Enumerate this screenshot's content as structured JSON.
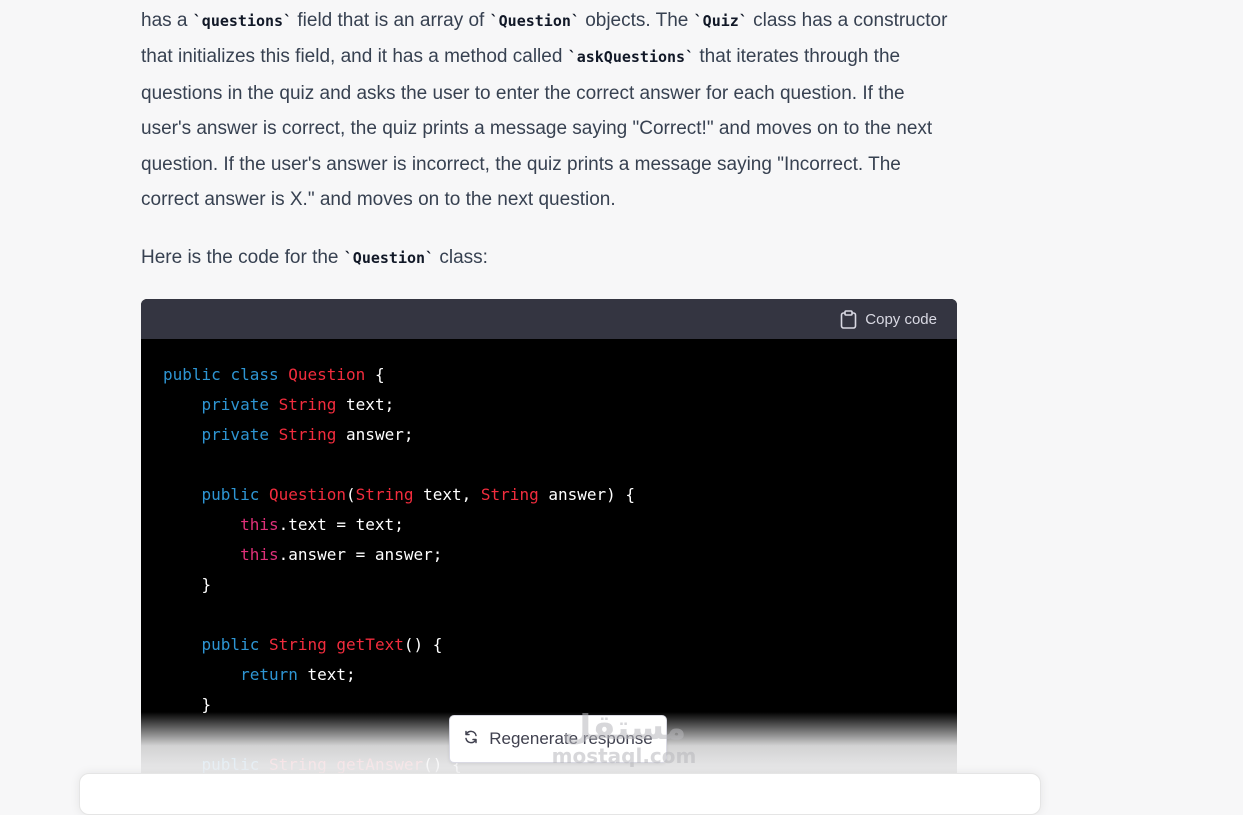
{
  "message": {
    "paragraph1": [
      {
        "t": "text",
        "v": "has a "
      },
      {
        "t": "code",
        "v": "`questions`"
      },
      {
        "t": "text",
        "v": " field that is an array of "
      },
      {
        "t": "code",
        "v": "`Question`"
      },
      {
        "t": "text",
        "v": " objects. The "
      },
      {
        "t": "code",
        "v": "`Quiz`"
      },
      {
        "t": "text",
        "v": " class has a constructor that initializes this field, and it has a method called "
      },
      {
        "t": "code",
        "v": "`askQuestions`"
      },
      {
        "t": "text",
        "v": " that iterates through the questions in the quiz and asks the user to enter the correct answer for each question. If the user's answer is correct, the quiz prints a message saying \"Correct!\" and moves on to the next question. If the user's answer is incorrect, the quiz prints a message saying \"Incorrect. The correct answer is X.\" and moves on to the next question."
      }
    ],
    "paragraph2": [
      {
        "t": "text",
        "v": "Here is the code for the "
      },
      {
        "t": "code",
        "v": "`Question`"
      },
      {
        "t": "text",
        "v": " class:"
      }
    ]
  },
  "code_block": {
    "copy_label": "Copy code",
    "copy_icon": "clipboard-icon",
    "lines": [
      [
        {
          "c": "kw",
          "v": "public"
        },
        {
          "c": "",
          "v": " "
        },
        {
          "c": "kw",
          "v": "class"
        },
        {
          "c": "",
          "v": " "
        },
        {
          "c": "ty",
          "v": "Question"
        },
        {
          "c": "",
          "v": " {"
        }
      ],
      [
        {
          "c": "",
          "v": "    "
        },
        {
          "c": "kw",
          "v": "private"
        },
        {
          "c": "",
          "v": " "
        },
        {
          "c": "ty",
          "v": "String"
        },
        {
          "c": "",
          "v": " text;"
        }
      ],
      [
        {
          "c": "",
          "v": "    "
        },
        {
          "c": "kw",
          "v": "private"
        },
        {
          "c": "",
          "v": " "
        },
        {
          "c": "ty",
          "v": "String"
        },
        {
          "c": "",
          "v": " answer;"
        }
      ],
      [],
      [
        {
          "c": "",
          "v": "    "
        },
        {
          "c": "kw",
          "v": "public"
        },
        {
          "c": "",
          "v": " "
        },
        {
          "c": "ty",
          "v": "Question"
        },
        {
          "c": "",
          "v": "("
        },
        {
          "c": "ty",
          "v": "String"
        },
        {
          "c": "",
          "v": " text, "
        },
        {
          "c": "ty",
          "v": "String"
        },
        {
          "c": "",
          "v": " answer) {"
        }
      ],
      [
        {
          "c": "",
          "v": "        "
        },
        {
          "c": "th",
          "v": "this"
        },
        {
          "c": "",
          "v": ".text = text;"
        }
      ],
      [
        {
          "c": "",
          "v": "        "
        },
        {
          "c": "th",
          "v": "this"
        },
        {
          "c": "",
          "v": ".answer = answer;"
        }
      ],
      [
        {
          "c": "",
          "v": "    }"
        }
      ],
      [],
      [
        {
          "c": "",
          "v": "    "
        },
        {
          "c": "kw",
          "v": "public"
        },
        {
          "c": "",
          "v": " "
        },
        {
          "c": "ty",
          "v": "String"
        },
        {
          "c": "",
          "v": " "
        },
        {
          "c": "ty",
          "v": "getText"
        },
        {
          "c": "",
          "v": "() {"
        }
      ],
      [
        {
          "c": "",
          "v": "        "
        },
        {
          "c": "kw",
          "v": "return"
        },
        {
          "c": "",
          "v": " text;"
        }
      ],
      [
        {
          "c": "",
          "v": "    }"
        }
      ],
      [],
      [
        {
          "c": "",
          "v": "    "
        },
        {
          "c": "kw",
          "v": "public"
        },
        {
          "c": "",
          "v": " "
        },
        {
          "c": "ty",
          "v": "String"
        },
        {
          "c": "",
          "v": " "
        },
        {
          "c": "ty",
          "v": "getAnswer"
        },
        {
          "c": "",
          "v": "() {"
        }
      ]
    ]
  },
  "regenerate": {
    "label": "Regenerate response",
    "icon": "refresh-icon"
  },
  "watermark": {
    "arabic": "مستقل",
    "latin": "mostaql.com"
  },
  "colors": {
    "keyword": "#2e95d3",
    "type": "#f22c3d",
    "this": "#df3079",
    "code_bg": "#000000",
    "code_header_bg": "#343541",
    "page_bg": "#f7f7f8"
  }
}
